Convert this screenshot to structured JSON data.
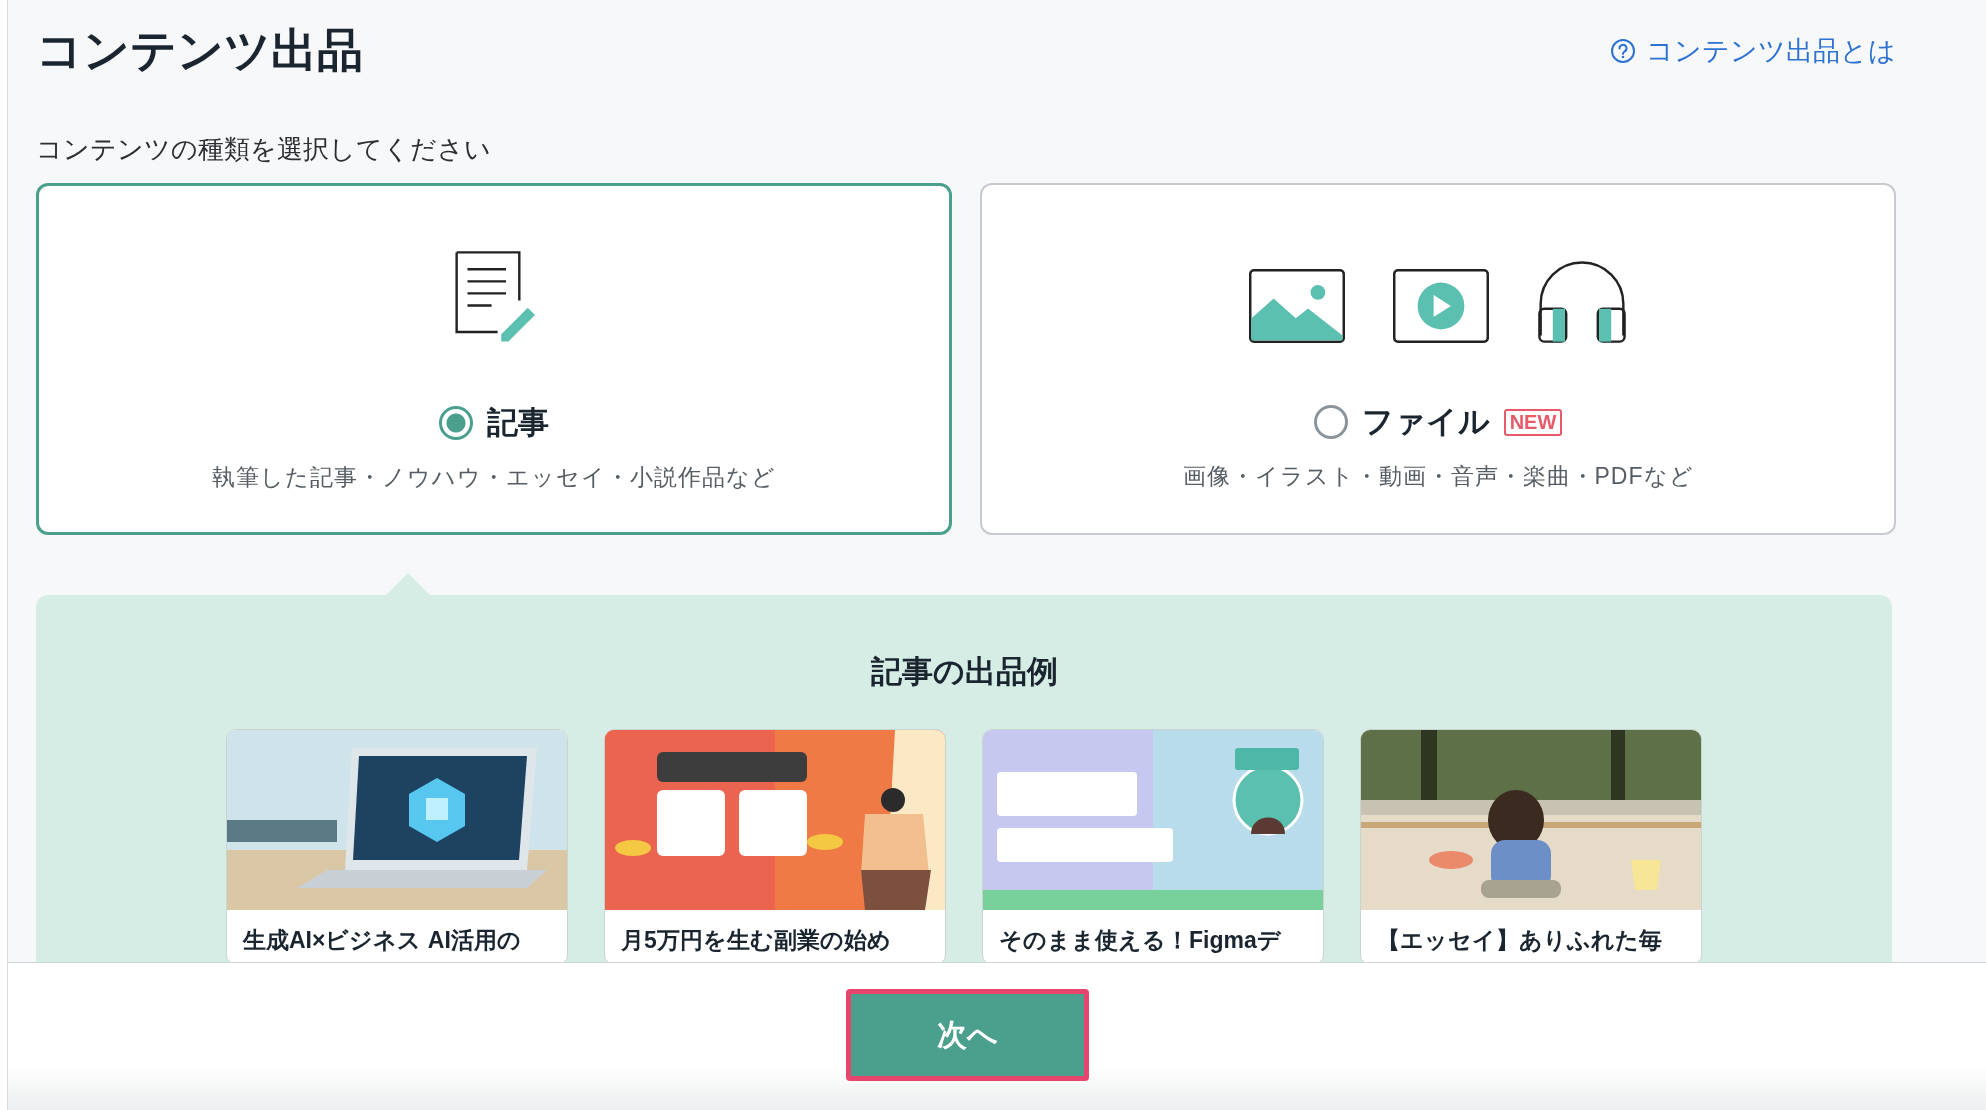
{
  "page": {
    "title": "コンテンツ出品",
    "help_link": "コンテンツ出品とは"
  },
  "prompt": "コンテンツの種類を選択してください",
  "content_types": [
    {
      "kind": "article",
      "label": "記事",
      "description": "執筆した記事・ノウハウ・エッセイ・小説作品など",
      "selected": true
    },
    {
      "kind": "file",
      "label": "ファイル",
      "badge": "NEW",
      "description": "画像・イラスト・動画・音声・楽曲・PDFなど",
      "selected": false
    }
  ],
  "examples": {
    "title": "記事の出品例",
    "items": [
      {
        "title": "生成AI×ビジネス AI活用の"
      },
      {
        "title": "月5万円を生む副業の始め"
      },
      {
        "title": "そのまま使える！Figmaデ"
      },
      {
        "title": "【エッセイ】ありふれた毎"
      }
    ]
  },
  "next_button": "次へ"
}
